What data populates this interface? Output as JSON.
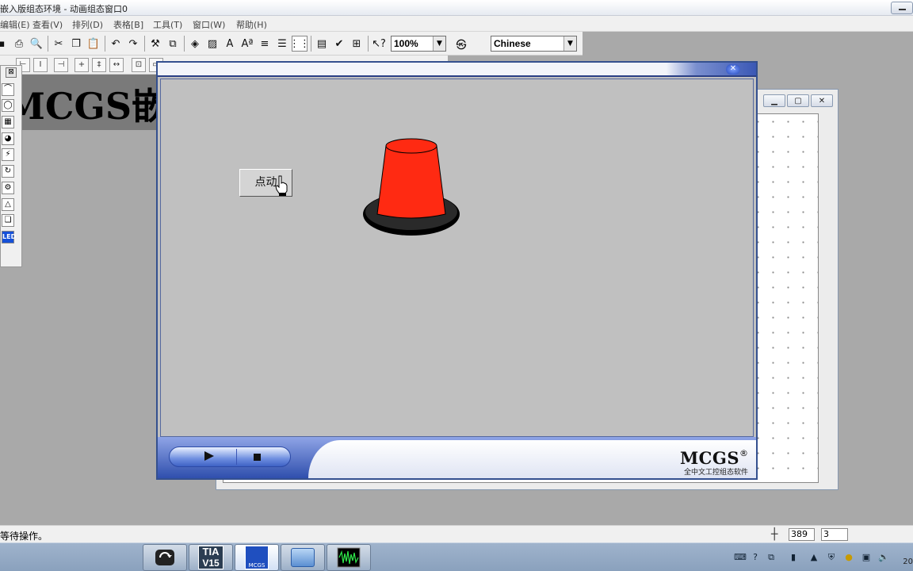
{
  "window": {
    "title": "嵌入版组态环境 - 动画组态窗口0"
  },
  "menubar": {
    "items": [
      "编辑(E)",
      "查看(V)",
      "排列(D)",
      "表格[B]",
      "工具(T)",
      "窗口(W)",
      "帮助(H)"
    ]
  },
  "toolbar": {
    "zoom_value": "100%",
    "language_value": "Chinese"
  },
  "canvas": {
    "heading_text": "MCGS嵌入"
  },
  "simulator": {
    "push_button_label": "点动",
    "brand": "MCGS",
    "brand_reg": "®",
    "brand_subtitle": "全中文工控组态软件",
    "lamp_color": "#ff2a12"
  },
  "statusbar": {
    "message": "等待操作。",
    "coord_x": "389",
    "coord_y": "3"
  },
  "taskbar": {
    "apps": [
      "windows-switcher-icon",
      "tia-portal-icon",
      "mcgs-icon",
      "control-panel-icon",
      "oscilloscope-icon"
    ],
    "tia_label_top": "TIA",
    "tia_label_bottom": "V15",
    "mcgs_label": "MCGS",
    "clock_fragment": "20"
  }
}
